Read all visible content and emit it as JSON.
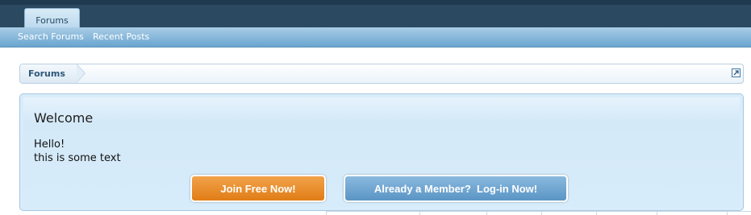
{
  "header": {
    "tabs": [
      {
        "label": "Forums"
      }
    ],
    "subnav": {
      "search_label": "Search Forums",
      "recent_label": "Recent Posts"
    }
  },
  "breadcrumb": {
    "items": [
      {
        "label": "Forums"
      }
    ]
  },
  "notice": {
    "title": "Welcome",
    "lines": [
      "Hello!",
      "this is some text"
    ],
    "join_label": "Join Free Now!",
    "login_label": "Already a Member?  Log-in Now!"
  },
  "colors": {
    "nav_bg": "#2b4a61",
    "subnav": "#6aa5cf",
    "notice_bg": "#d9ecfa",
    "join_button": "#e8871f",
    "login_button": "#6aa3d0"
  },
  "icons": {
    "jump": "jump-to-icon"
  }
}
